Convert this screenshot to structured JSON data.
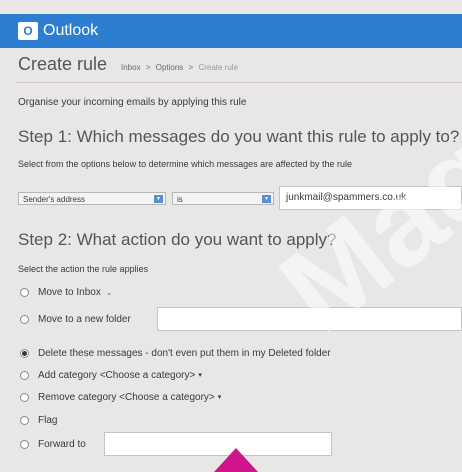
{
  "app": {
    "logo_text": "O",
    "title": "Outlook"
  },
  "header": {
    "page_title": "Create rule",
    "breadcrumb": [
      "Inbox",
      "Options",
      "Create rule"
    ],
    "breadcrumb_sep": ">"
  },
  "intro": "Organise your incoming emails by applying this rule",
  "step1": {
    "title": "Step 1: Which messages do you want this rule to apply to?",
    "desc": "Select from the options below to determine which messages are affected by the rule",
    "field_select": "Sender's address",
    "operator_select": "is",
    "value": "junkmail@spammers.co.uk"
  },
  "step2": {
    "title": "Step 2: What action do you want to apply?",
    "desc": "Select the action the rule applies",
    "options": [
      {
        "label": "Move to Inbox",
        "suffix": "⌄",
        "checked": false
      },
      {
        "label": "Move to a new folder",
        "checked": false
      },
      {
        "label": "Delete these messages - don't even put them in my Deleted folder",
        "checked": true
      },
      {
        "label": "Add category <Choose a category>",
        "suffix": "▾",
        "checked": false
      },
      {
        "label": "Remove category <Choose a category>",
        "suffix": "▾",
        "checked": false
      },
      {
        "label": "Flag",
        "checked": false
      },
      {
        "label": "Forward to",
        "checked": false
      }
    ]
  },
  "watermark": "Mag",
  "colors": {
    "topbar": "#2d7ed1",
    "frame_bg": "#e9e6e6",
    "accent_pink": "#d0158a"
  }
}
